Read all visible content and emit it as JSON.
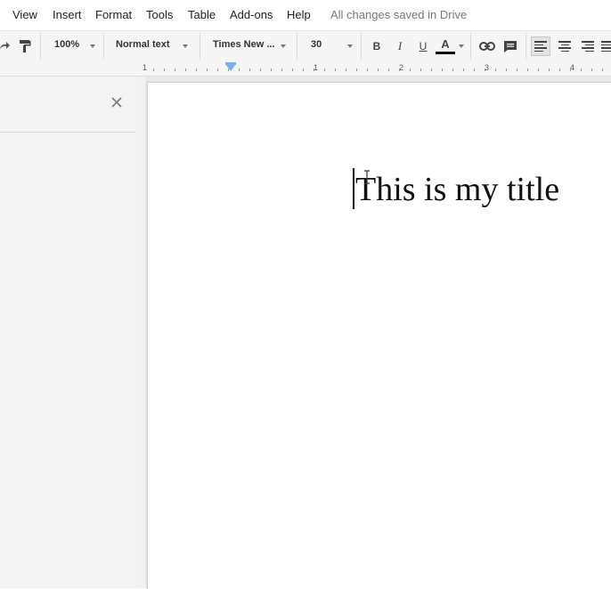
{
  "menubar": {
    "items": [
      "View",
      "Insert",
      "Format",
      "Tools",
      "Table",
      "Add-ons",
      "Help"
    ],
    "save_status": "All changes saved in Drive"
  },
  "toolbar": {
    "zoom": "100%",
    "style": "Normal text",
    "font": "Times New ...",
    "font_size": "30",
    "bold_label": "B",
    "italic_label": "I",
    "underline_label": "U",
    "text_color_label": "A",
    "text_color": "#000000"
  },
  "ruler": {
    "numbers": [
      "1",
      "1",
      "2",
      "3",
      "4"
    ]
  },
  "document": {
    "title_text": "This is my title"
  }
}
